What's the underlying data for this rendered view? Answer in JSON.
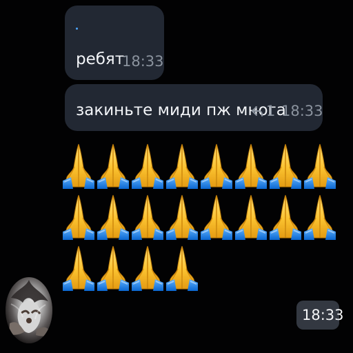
{
  "colors": {
    "background": "#020203",
    "bubble": "#222833",
    "secondary_text": "#8b939e",
    "time_badge": "#333841",
    "accent": "#4ea7ff"
  },
  "messages": [
    {
      "text": "ребят",
      "time": "18:33"
    },
    {
      "text": "закиньте миди пж многа",
      "reply_count": "1",
      "time": "18:33"
    }
  ],
  "emoji_message": {
    "emoji": "praying-hands",
    "count": 20,
    "time": "18:33"
  },
  "icons": {
    "reply": "reply-icon",
    "emoji": "praying-hands-icon",
    "avatar": "cat-avatar"
  }
}
